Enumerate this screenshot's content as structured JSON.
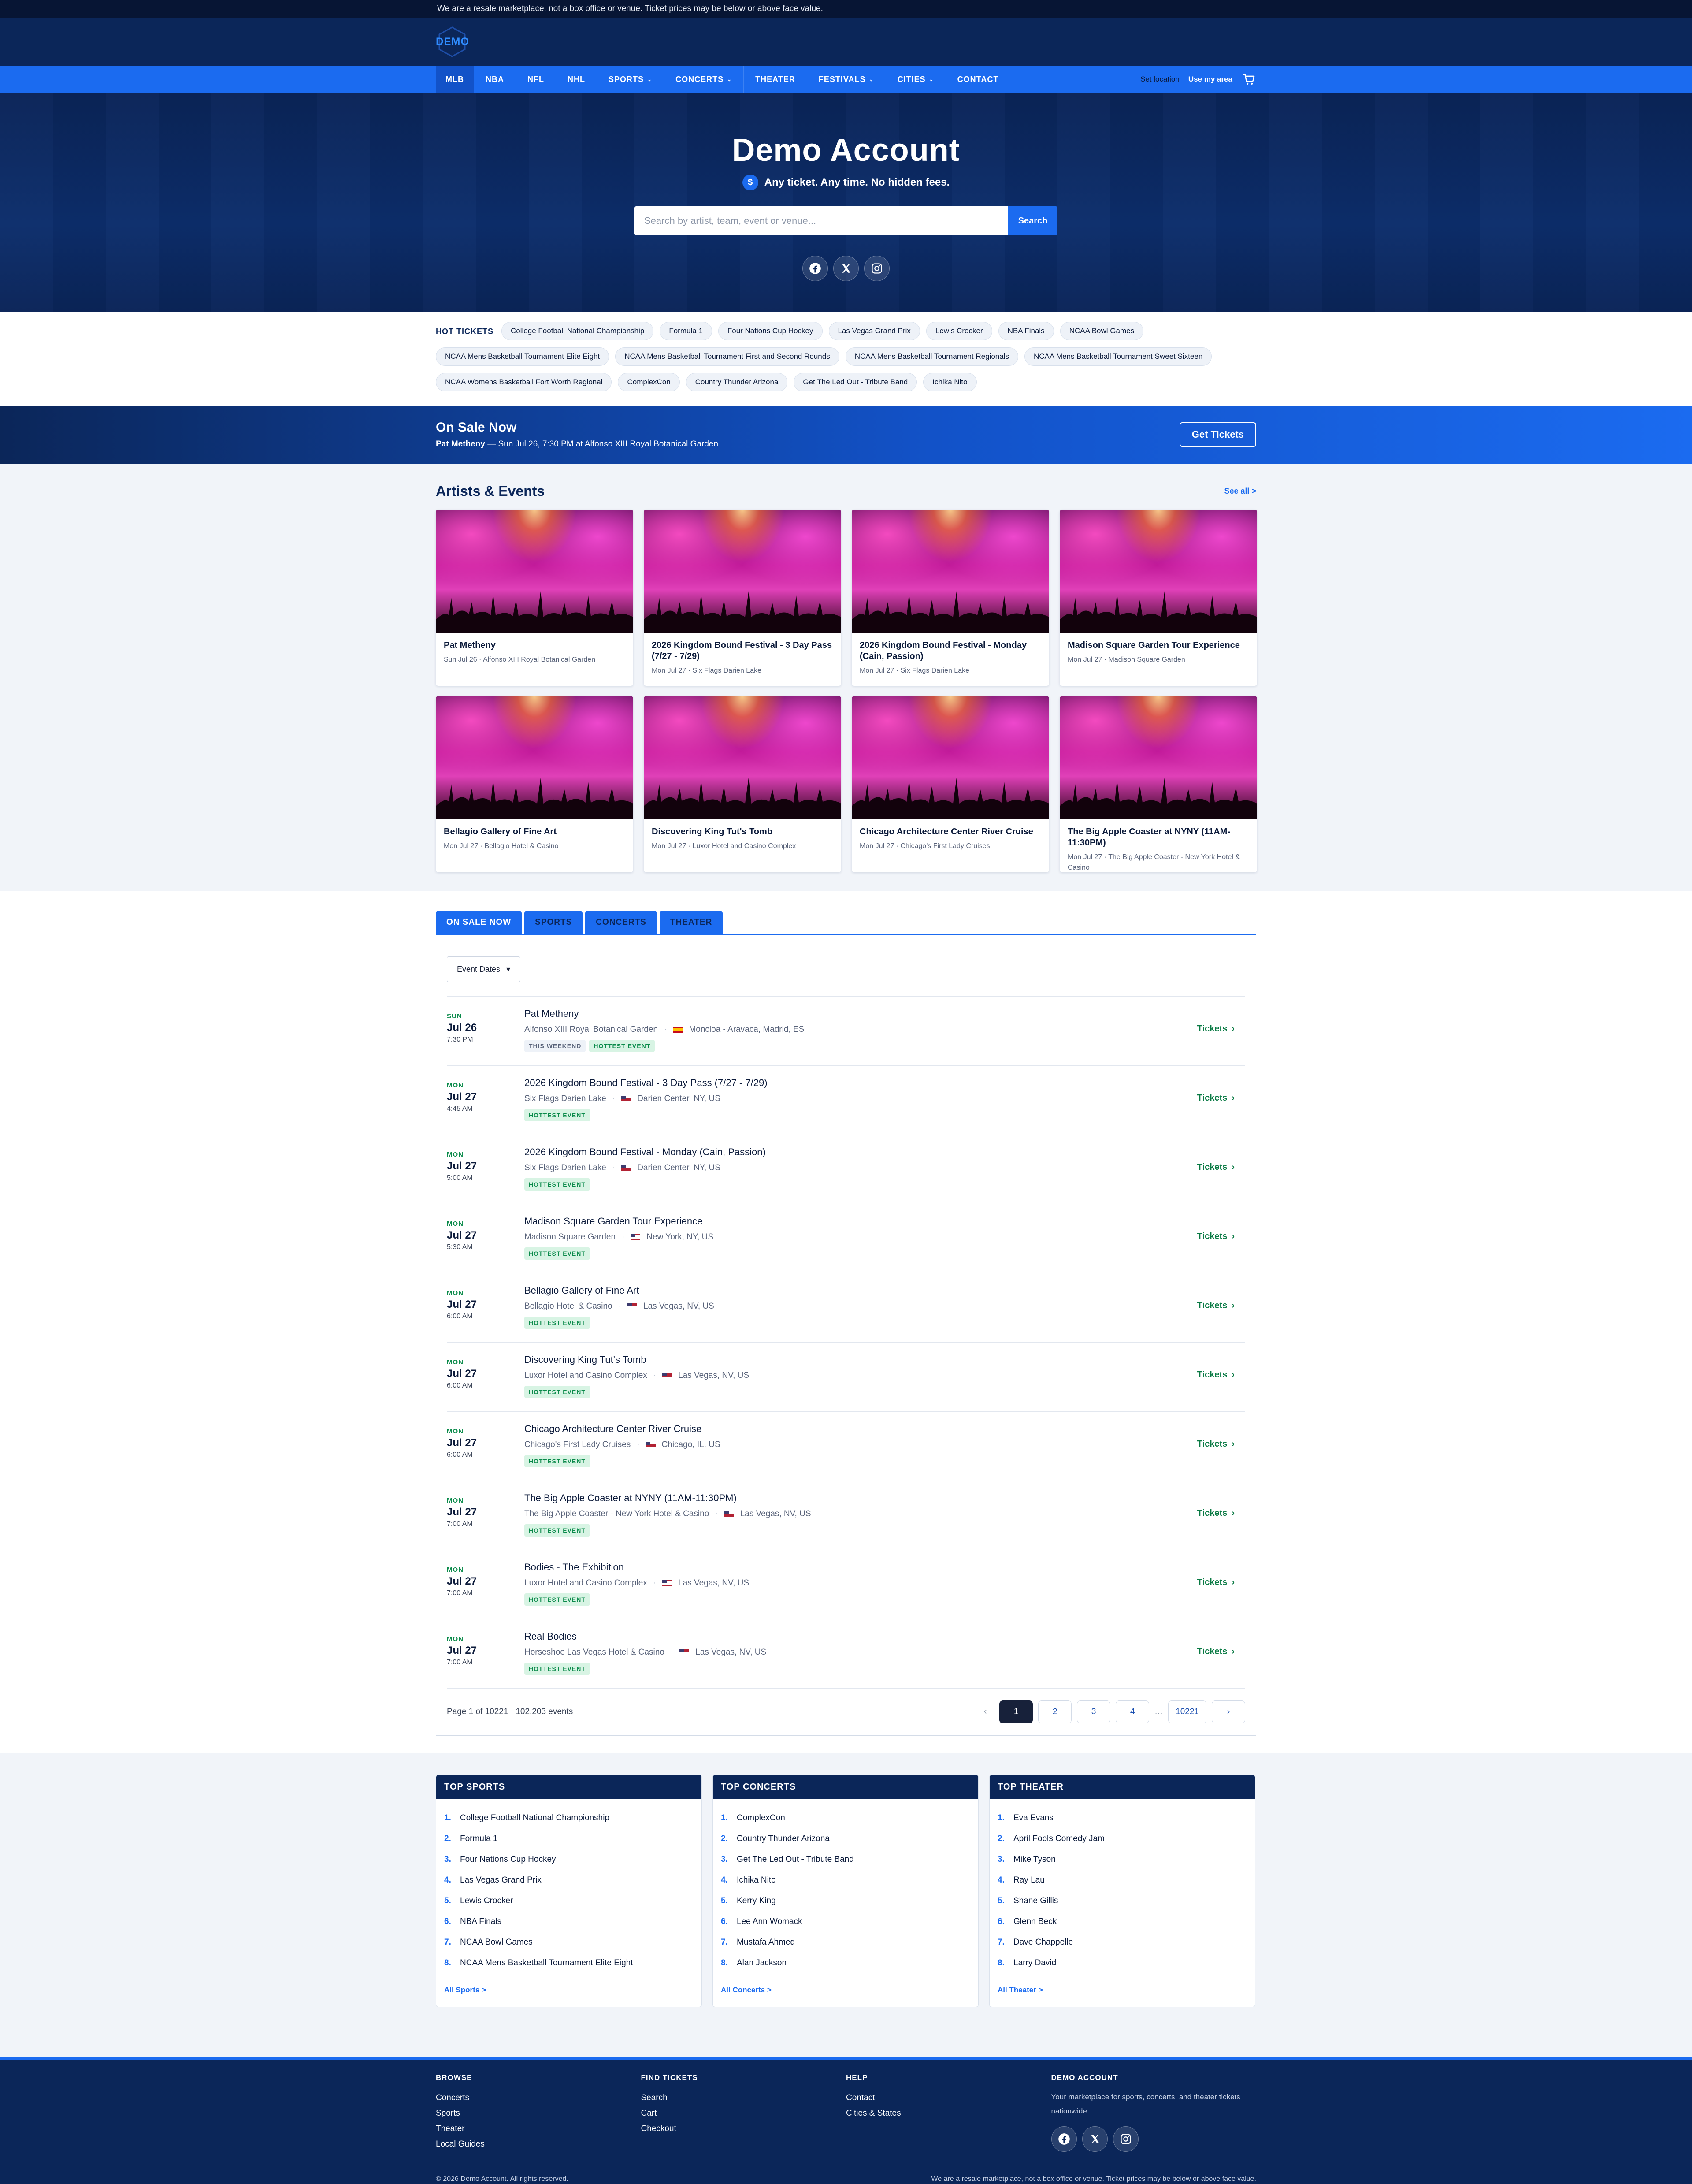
{
  "notice": "We are a resale marketplace, not a box office or venue. Ticket prices may be below or above face value.",
  "logo_text": "DEMO",
  "nav": {
    "items": [
      "MLB",
      "NBA",
      "NFL",
      "NHL",
      "SPORTS",
      "CONCERTS",
      "THEATER",
      "FESTIVALS",
      "CITIES",
      "CONTACT"
    ],
    "set_location": "Set location",
    "use_my_area": "Use my area"
  },
  "hero": {
    "title": "Demo Account",
    "tagline": "Any ticket. Any time. No hidden fees.",
    "dollar": "$",
    "search_placeholder": "Search by artist, team, event or venue...",
    "search_button": "Search"
  },
  "hot_tickets": {
    "label": "HOT TICKETS",
    "items": [
      "College Football National Championship",
      "Formula 1",
      "Four Nations Cup Hockey",
      "Las Vegas Grand Prix",
      "Lewis Crocker",
      "NBA Finals",
      "NCAA Bowl Games",
      "NCAA Mens Basketball Tournament Elite Eight",
      "NCAA Mens Basketball Tournament First and Second Rounds",
      "NCAA Mens Basketball Tournament Regionals",
      "NCAA Mens Basketball Tournament Sweet Sixteen",
      "NCAA Womens Basketball Fort Worth Regional",
      "ComplexCon",
      "Country Thunder Arizona",
      "Get The Led Out - Tribute Band",
      "Ichika Nito"
    ]
  },
  "on_sale": {
    "title": "On Sale Now",
    "artist": "Pat Metheny",
    "detail": " — Sun Jul 26, 7:30 PM at Alfonso XIII Royal Botanical Garden",
    "button": "Get Tickets"
  },
  "artists": {
    "title": "Artists & Events",
    "see_all": "See all >",
    "cards": [
      {
        "title": "Pat Metheny",
        "sub": "Sun Jul 26 · Alfonso XIII Royal Botanical Garden"
      },
      {
        "title": "2026 Kingdom Bound Festival - 3 Day Pass (7/27 - 7/29)",
        "sub": "Mon Jul 27 · Six Flags Darien Lake"
      },
      {
        "title": "2026 Kingdom Bound Festival - Monday (Cain, Passion)",
        "sub": "Mon Jul 27 · Six Flags Darien Lake"
      },
      {
        "title": "Madison Square Garden Tour Experience",
        "sub": "Mon Jul 27 · Madison Square Garden"
      },
      {
        "title": "Bellagio Gallery of Fine Art",
        "sub": "Mon Jul 27 · Bellagio Hotel & Casino"
      },
      {
        "title": "Discovering King Tut's Tomb",
        "sub": "Mon Jul 27 · Luxor Hotel and Casino Complex"
      },
      {
        "title": "Chicago Architecture Center River Cruise",
        "sub": "Mon Jul 27 · Chicago's First Lady Cruises"
      },
      {
        "title": "The Big Apple Coaster at NYNY (11AM-11:30PM)",
        "sub": "Mon Jul 27 · The Big Apple Coaster - New York Hotel & Casino"
      }
    ]
  },
  "tabs": [
    "ON SALE NOW",
    "SPORTS",
    "CONCERTS",
    "THEATER"
  ],
  "dropdown_label": "Event Dates",
  "events": [
    {
      "dow": "SUN",
      "day": "Jul 26",
      "time": "7:30 PM",
      "name": "Pat Metheny",
      "venue": "Alfonso XIII Royal Botanical Garden",
      "location": "Moncloa - Aravaca, Madrid, ES",
      "flag": "es",
      "badges": [
        "THIS WEEKEND",
        "HOTTEST EVENT"
      ]
    },
    {
      "dow": "MON",
      "day": "Jul 27",
      "time": "4:45 AM",
      "name": "2026 Kingdom Bound Festival - 3 Day Pass (7/27 - 7/29)",
      "venue": "Six Flags Darien Lake",
      "location": "Darien Center, NY, US",
      "flag": "us",
      "badges": [
        "HOTTEST EVENT"
      ]
    },
    {
      "dow": "MON",
      "day": "Jul 27",
      "time": "5:00 AM",
      "name": "2026 Kingdom Bound Festival - Monday (Cain, Passion)",
      "venue": "Six Flags Darien Lake",
      "location": "Darien Center, NY, US",
      "flag": "us",
      "badges": [
        "HOTTEST EVENT"
      ]
    },
    {
      "dow": "MON",
      "day": "Jul 27",
      "time": "5:30 AM",
      "name": "Madison Square Garden Tour Experience",
      "venue": "Madison Square Garden",
      "location": "New York, NY, US",
      "flag": "us",
      "badges": [
        "HOTTEST EVENT"
      ]
    },
    {
      "dow": "MON",
      "day": "Jul 27",
      "time": "6:00 AM",
      "name": "Bellagio Gallery of Fine Art",
      "venue": "Bellagio Hotel & Casino",
      "location": "Las Vegas, NV, US",
      "flag": "us",
      "badges": [
        "HOTTEST EVENT"
      ]
    },
    {
      "dow": "MON",
      "day": "Jul 27",
      "time": "6:00 AM",
      "name": "Discovering King Tut's Tomb",
      "venue": "Luxor Hotel and Casino Complex",
      "location": "Las Vegas, NV, US",
      "flag": "us",
      "badges": [
        "HOTTEST EVENT"
      ]
    },
    {
      "dow": "MON",
      "day": "Jul 27",
      "time": "6:00 AM",
      "name": "Chicago Architecture Center River Cruise",
      "venue": "Chicago's First Lady Cruises",
      "location": "Chicago, IL, US",
      "flag": "us",
      "badges": [
        "HOTTEST EVENT"
      ]
    },
    {
      "dow": "MON",
      "day": "Jul 27",
      "time": "7:00 AM",
      "name": "The Big Apple Coaster at NYNY (11AM-11:30PM)",
      "venue": "The Big Apple Coaster - New York Hotel & Casino",
      "location": "Las Vegas, NV, US",
      "flag": "us",
      "badges": [
        "HOTTEST EVENT"
      ]
    },
    {
      "dow": "MON",
      "day": "Jul 27",
      "time": "7:00 AM",
      "name": "Bodies - The Exhibition",
      "venue": "Luxor Hotel and Casino Complex",
      "location": "Las Vegas, NV, US",
      "flag": "us",
      "badges": [
        "HOTTEST EVENT"
      ]
    },
    {
      "dow": "MON",
      "day": "Jul 27",
      "time": "7:00 AM",
      "name": "Real Bodies",
      "venue": "Horseshoe Las Vegas Hotel & Casino",
      "location": "Las Vegas, NV, US",
      "flag": "us",
      "badges": [
        "HOTTEST EVENT"
      ]
    }
  ],
  "tickets_label": "Tickets",
  "pager": {
    "info": "Page 1 of 10221 · 102,203 events",
    "prev": "‹",
    "pages": [
      "1",
      "2",
      "3",
      "4"
    ],
    "ellipsis": "…",
    "last": "10221",
    "next": "›"
  },
  "top_lists": [
    {
      "title": "TOP SPORTS",
      "items": [
        "College Football National Championship",
        "Formula 1",
        "Four Nations Cup Hockey",
        "Las Vegas Grand Prix",
        "Lewis Crocker",
        "NBA Finals",
        "NCAA Bowl Games",
        "NCAA Mens Basketball Tournament Elite Eight"
      ],
      "link": "All Sports >"
    },
    {
      "title": "TOP CONCERTS",
      "items": [
        "ComplexCon",
        "Country Thunder Arizona",
        "Get The Led Out - Tribute Band",
        "Ichika Nito",
        "Kerry King",
        "Lee Ann Womack",
        "Mustafa Ahmed",
        "Alan Jackson"
      ],
      "link": "All Concerts >"
    },
    {
      "title": "TOP THEATER",
      "items": [
        "Eva Evans",
        "April Fools Comedy Jam",
        "Mike Tyson",
        "Ray Lau",
        "Shane Gillis",
        "Glenn Beck",
        "Dave Chappelle",
        "Larry David"
      ],
      "link": "All Theater >"
    }
  ],
  "footer": {
    "cols": [
      {
        "title": "BROWSE",
        "links": [
          "Concerts",
          "Sports",
          "Theater",
          "Local Guides"
        ]
      },
      {
        "title": "FIND TICKETS",
        "links": [
          "Search",
          "Cart",
          "Checkout"
        ]
      },
      {
        "title": "HELP",
        "links": [
          "Contact",
          "Cities & States"
        ]
      }
    ],
    "account_title": "DEMO ACCOUNT",
    "account_text": "Your marketplace for sports, concerts, and theater tickets nationwide.",
    "copyright": "© 2026 Demo Account. All rights reserved.",
    "notice": "We are a resale marketplace, not a box office or venue. Ticket prices may be below or above face value."
  },
  "colors": {
    "primary": "#1b6bf0",
    "navy": "#0b2659",
    "green": "#0a8a4a"
  }
}
